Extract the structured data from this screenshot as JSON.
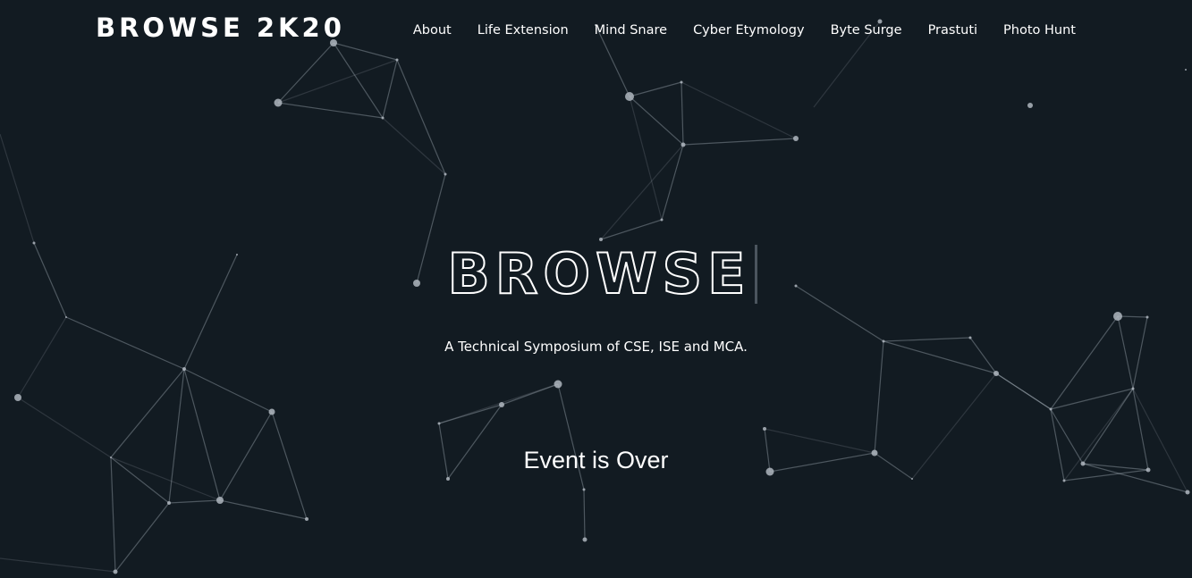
{
  "header": {
    "logo": "BROWSE 2K20"
  },
  "nav": {
    "items": [
      {
        "label": "About"
      },
      {
        "label": "Life Extension"
      },
      {
        "label": "Mind Snare"
      },
      {
        "label": "Cyber Etymology"
      },
      {
        "label": "Byte Surge"
      },
      {
        "label": "Prastuti"
      },
      {
        "label": "Photo Hunt"
      }
    ]
  },
  "hero": {
    "title": "BROWSE",
    "tagline": "A Technical Symposium of CSE, ISE and MCA.",
    "status": "Event is Over"
  },
  "colors": {
    "background": "#121b22",
    "text": "#ffffff",
    "particles": "#afb6be"
  }
}
